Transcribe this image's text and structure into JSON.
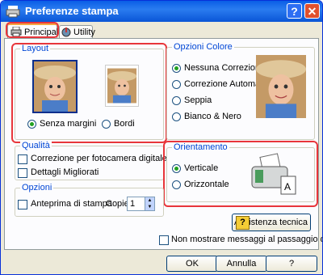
{
  "window": {
    "title": "Preferenze stampa",
    "help_label": "?",
    "close_label": "✕"
  },
  "tabs": [
    {
      "label": "Principale"
    },
    {
      "label": "Utility"
    }
  ],
  "layout": {
    "title": "Layout",
    "option1": "Senza margini",
    "option2": "Bordi"
  },
  "color": {
    "title": "Opzioni Colore",
    "options": [
      "Nessuna Correzione",
      "Correzione Automatica",
      "Seppia",
      "Bianco & Nero"
    ]
  },
  "quality": {
    "title": "Qualità",
    "options": [
      "Correzione per fotocamera digitale",
      "Dettagli Migliorati"
    ]
  },
  "orientation": {
    "title": "Orientamento",
    "options": [
      "Verticale",
      "Orizzontale"
    ]
  },
  "options": {
    "title": "Opzioni",
    "preview": "Anteprima di stampa",
    "copies_label": "Copie",
    "copies_value": "1"
  },
  "assist": {
    "label": "Assistenza tecnica"
  },
  "no_messages": "Non mostrare messaggi al passaggio del mouse.",
  "buttons": {
    "ok": "OK",
    "cancel": "Annulla",
    "help": "?"
  },
  "colors": {
    "accent": "#0046d5",
    "highlight": "#e8363b",
    "titlebar": "#0a5ee6"
  }
}
